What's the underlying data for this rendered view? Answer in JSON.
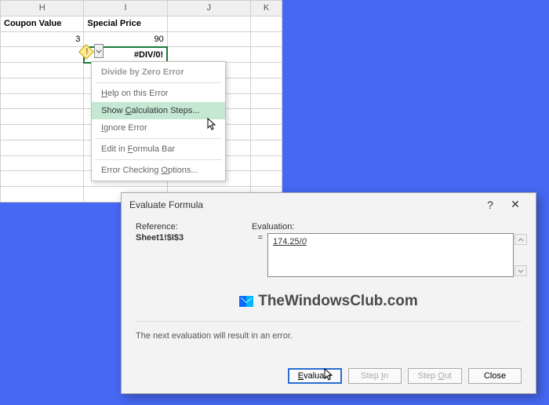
{
  "grid": {
    "columns": [
      "H",
      "I",
      "J",
      "K"
    ],
    "headers": {
      "h": "Coupon Value",
      "i": "Special Price"
    },
    "row2": {
      "h": "3",
      "i": "90"
    },
    "row3": {
      "i": "#DIV/0!"
    }
  },
  "error_menu": {
    "title": "Divide by Zero Error",
    "help": "Help on this Error",
    "show_calc": "Show Calculation Steps...",
    "ignore": "Ignore Error",
    "edit_bar": "Edit in Formula Bar",
    "options": "Error Checking Options..."
  },
  "dialog": {
    "title": "Evaluate Formula",
    "help_q": "?",
    "close_x": "✕",
    "reference_label": "Reference:",
    "reference_value": "Sheet1!$I$3",
    "evaluation_label": "Evaluation:",
    "eq": "=",
    "formula_left": "174.25/",
    "formula_right": "0",
    "status": "The next evaluation will result in an error.",
    "buttons": {
      "evaluate": "Evaluate",
      "step_in": "Step In",
      "step_out": "Step Out",
      "close": "Close"
    }
  },
  "watermark": "TheWindowsClub.com"
}
